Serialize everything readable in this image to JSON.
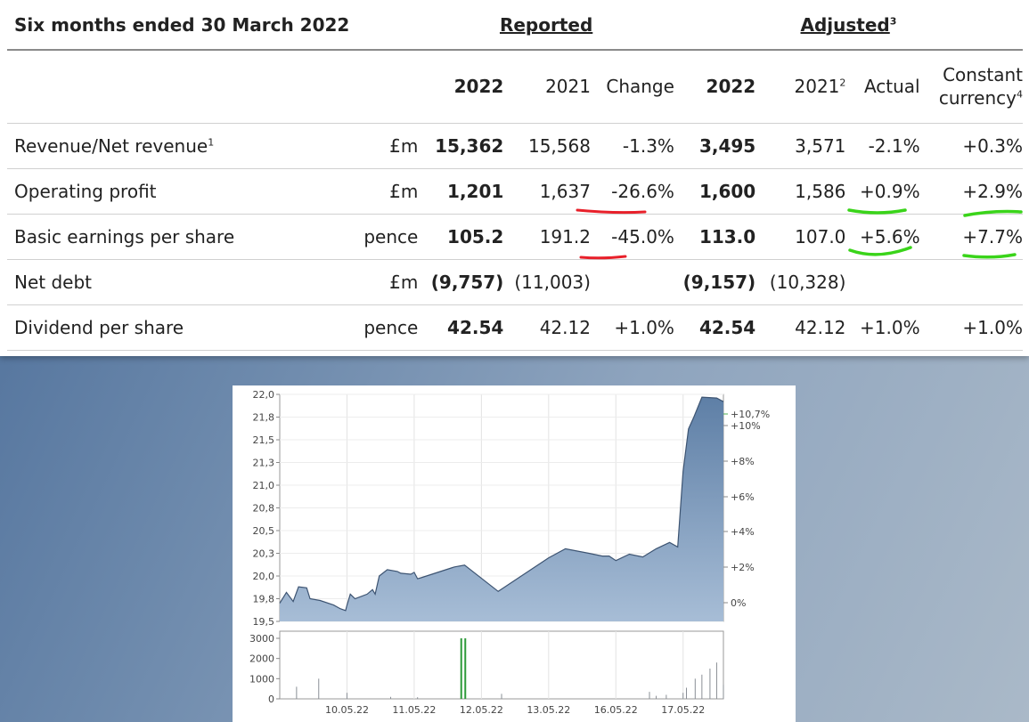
{
  "table": {
    "title": "Six months ended 30 March 2022",
    "group_reported": "Reported",
    "group_adjusted": "Adjusted",
    "group_adjusted_sup": "3",
    "columns": [
      "2022",
      "2021",
      "Change",
      "2022",
      "2021",
      "Actual",
      "Constant currency"
    ],
    "col_2021_adj_sup": "2",
    "col_cc_line1": "Constant",
    "col_cc_line2": "currency",
    "col_cc_sup": "4",
    "rows": [
      {
        "label": "Revenue/Net revenue",
        "sup": "1",
        "unit": "£m",
        "rep_2022": "15,362",
        "rep_2021": "15,568",
        "change": "-1.3%",
        "adj_2022": "3,495",
        "adj_2021": "3,571",
        "actual": "-2.1%",
        "cc": "+0.3%"
      },
      {
        "label": "Operating profit",
        "sup": "",
        "unit": "£m",
        "rep_2022": "1,201",
        "rep_2021": "1,637",
        "change": "-26.6%",
        "adj_2022": "1,600",
        "adj_2021": "1,586",
        "actual": "+0.9%",
        "cc": "+2.9%"
      },
      {
        "label": "Basic earnings per share",
        "sup": "",
        "unit": "pence",
        "rep_2022": "105.2",
        "rep_2021": "191.2",
        "change": "-45.0%",
        "adj_2022": "113.0",
        "adj_2021": "107.0",
        "actual": "+5.6%",
        "cc": "+7.7%"
      },
      {
        "label": "Net debt",
        "sup": "",
        "unit": "£m",
        "rep_2022": "(9,757)",
        "rep_2021": "(11,003)",
        "change": "",
        "adj_2022": "(9,157)",
        "adj_2021": "(10,328)",
        "actual": "",
        "cc": ""
      },
      {
        "label": "Dividend per share",
        "sup": "",
        "unit": "pence",
        "rep_2022": "42.54",
        "rep_2021": "42.12",
        "change": "+1.0%",
        "adj_2022": "42.54",
        "adj_2021": "42.12",
        "actual": "+1.0%",
        "cc": "+1.0%"
      }
    ],
    "colors": {
      "red_mark": "#e8202a",
      "green_mark": "#3ad41a"
    }
  },
  "chart_data": {
    "type": "area",
    "price_ylim": [
      19.5,
      22.0
    ],
    "price_ticks": [
      "22,0",
      "21,8",
      "21,5",
      "21,3",
      "21,0",
      "20,8",
      "20,5",
      "20,3",
      "20,0",
      "19,8",
      "19,5"
    ],
    "pct_ticks": [
      "+10%",
      "+8%",
      "+6%",
      "+4%",
      "+2%",
      "0%"
    ],
    "pct_last_label": "+10,7%",
    "x_labels": [
      "10.05.22",
      "11.05.22",
      "12.05.22",
      "13.05.22",
      "16.05.22",
      "17.05.22"
    ],
    "volume_ylim": [
      0,
      3000
    ],
    "volume_ticks": [
      "3000",
      "2000",
      "1000",
      "0"
    ],
    "price_series": [
      {
        "t": 0.0,
        "v": 19.7
      },
      {
        "t": 0.1,
        "v": 19.82
      },
      {
        "t": 0.2,
        "v": 19.72
      },
      {
        "t": 0.28,
        "v": 19.88
      },
      {
        "t": 0.4,
        "v": 19.87
      },
      {
        "t": 0.45,
        "v": 19.75
      },
      {
        "t": 0.6,
        "v": 19.73
      },
      {
        "t": 0.8,
        "v": 19.68
      },
      {
        "t": 0.9,
        "v": 19.64
      },
      {
        "t": 0.98,
        "v": 19.62
      },
      {
        "t": 1.0,
        "v": 19.68
      },
      {
        "t": 1.05,
        "v": 19.8
      },
      {
        "t": 1.12,
        "v": 19.75
      },
      {
        "t": 1.3,
        "v": 19.8
      },
      {
        "t": 1.38,
        "v": 19.85
      },
      {
        "t": 1.42,
        "v": 19.8
      },
      {
        "t": 1.48,
        "v": 20.0
      },
      {
        "t": 1.6,
        "v": 20.07
      },
      {
        "t": 1.75,
        "v": 20.05
      },
      {
        "t": 1.8,
        "v": 20.03
      },
      {
        "t": 1.95,
        "v": 20.02
      },
      {
        "t": 2.0,
        "v": 20.04
      },
      {
        "t": 2.05,
        "v": 19.97
      },
      {
        "t": 2.1,
        "v": 19.98
      },
      {
        "t": 2.6,
        "v": 20.1
      },
      {
        "t": 2.75,
        "v": 20.12
      },
      {
        "t": 3.25,
        "v": 19.83
      },
      {
        "t": 4.0,
        "v": 20.2
      },
      {
        "t": 4.25,
        "v": 20.3
      },
      {
        "t": 4.6,
        "v": 20.25
      },
      {
        "t": 4.8,
        "v": 20.22
      },
      {
        "t": 4.9,
        "v": 20.22
      },
      {
        "t": 5.0,
        "v": 20.17
      },
      {
        "t": 5.2,
        "v": 20.24
      },
      {
        "t": 5.4,
        "v": 20.21
      },
      {
        "t": 5.6,
        "v": 20.3
      },
      {
        "t": 5.8,
        "v": 20.37
      },
      {
        "t": 5.92,
        "v": 20.32
      },
      {
        "t": 6.0,
        "v": 21.15
      },
      {
        "t": 6.08,
        "v": 21.62
      },
      {
        "t": 6.16,
        "v": 21.75
      },
      {
        "t": 6.28,
        "v": 21.97
      },
      {
        "t": 6.5,
        "v": 21.96
      },
      {
        "t": 6.6,
        "v": 21.92
      }
    ],
    "volume_series": [
      {
        "t": 0.25,
        "v": 600
      },
      {
        "t": 0.58,
        "v": 1000
      },
      {
        "t": 1.0,
        "v": 300
      },
      {
        "t": 1.65,
        "v": 100
      },
      {
        "t": 2.05,
        "v": 80
      },
      {
        "t": 2.7,
        "v": 3000
      },
      {
        "t": 2.76,
        "v": 3000
      },
      {
        "t": 3.3,
        "v": 250
      },
      {
        "t": 5.5,
        "v": 350
      },
      {
        "t": 5.6,
        "v": 150
      },
      {
        "t": 5.75,
        "v": 200
      },
      {
        "t": 6.0,
        "v": 300
      },
      {
        "t": 6.05,
        "v": 550
      },
      {
        "t": 6.18,
        "v": 1000
      },
      {
        "t": 6.28,
        "v": 1200
      },
      {
        "t": 6.4,
        "v": 1500
      },
      {
        "t": 6.5,
        "v": 1800
      },
      {
        "t": 6.6,
        "v": 700
      }
    ]
  }
}
